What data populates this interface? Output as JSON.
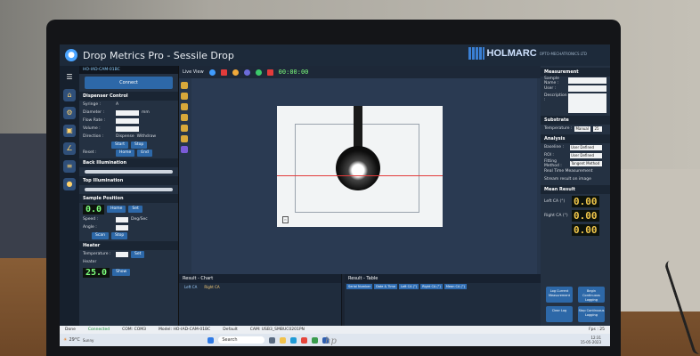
{
  "window": {
    "title": "Drop Metrics Pro - Sessile Drop",
    "brand": "HOLMARC",
    "brand_sub": "OPTO-MECHATRONICS LTD"
  },
  "left_panel": {
    "camera": "HO-IAD-CAM-01BC",
    "connect": "Connect",
    "dispenser": {
      "title": "Dispenser Control",
      "syringe": "Syringe :",
      "syringe_value": "A",
      "diameter": "Diameter :",
      "diameter_unit": "mm",
      "flow_rate": "Flow Rate :",
      "volume": "Volume :",
      "direction": "Direction :",
      "dispense": "Dispense",
      "withdraw": "Withdraw",
      "start": "Start",
      "stop": "Stop",
      "reset": "Reset :",
      "home": "Home",
      "end": "End"
    },
    "back_illumination": "Back Illumination",
    "top_illumination": "Top Illumination",
    "sample_position": {
      "title": "Sample Position",
      "value": "0.0",
      "speed": "Speed :",
      "speed_unit": "Deg/Sec",
      "angle": "Angle :",
      "home": "Home",
      "set": "Set",
      "scan": "Scan",
      "stop": "Stop"
    },
    "heater": {
      "title": "Heater",
      "temperature": "Temperature :",
      "heater": "Heater",
      "value": "25.0",
      "set": "Set",
      "show": "Show"
    }
  },
  "center": {
    "live_view": "Live View",
    "timer": "00:00:00",
    "result_chart": "Result - Chart",
    "left_ca": "Left CA",
    "right_ca": "Right CA",
    "result_table": "Result - Table",
    "table_headers": [
      "Serial Number",
      "Date & Time",
      "Left CA (°)",
      "Right CA (°)",
      "Mean CA (°)"
    ]
  },
  "right_panel": {
    "measurement": "Measurement",
    "sample_name": "Sample Name :",
    "user": "User :",
    "description": "Description :",
    "substrate": "Substrate",
    "temperature": "Temperature :",
    "mode": "Manual",
    "temp_value": "25",
    "analysis": "Analysis",
    "baseline": "Baseline :",
    "baseline_value": "User Defined",
    "roi": "ROI :",
    "roi_value": "User Defined",
    "fitting_method": "Fitting Method :",
    "fitting_value": "Tangent Method",
    "real_time": "Real Time Measurement",
    "stream": "Stream result on image",
    "mean_ca": "Mean Result",
    "left_ca": "Left CA (°)",
    "right_ca": "Right CA (°)",
    "left_ca_value": "0.00",
    "right_ca_value": "0.00",
    "mean_value": "0.00",
    "log_current": "Log Current Measurement",
    "begin_logging": "Begin Continuous Logging",
    "clear_log": "Clear Log",
    "stop_logging": "Stop Continuous Logging"
  },
  "status_bar": {
    "state": "Done",
    "connected": "Connected",
    "com": "COM: COM3",
    "model": "Model: HO-IAD-CAM-01BC",
    "default": "Default",
    "cam": "CAM: USB3_SMBUC0201PN",
    "fps": "Fps : 25"
  },
  "taskbar": {
    "weather": "29°C",
    "weather_sub": "Sunny",
    "search": "Search",
    "time": "12:31",
    "date": "15-05-2023"
  },
  "brand_logo": "hp"
}
